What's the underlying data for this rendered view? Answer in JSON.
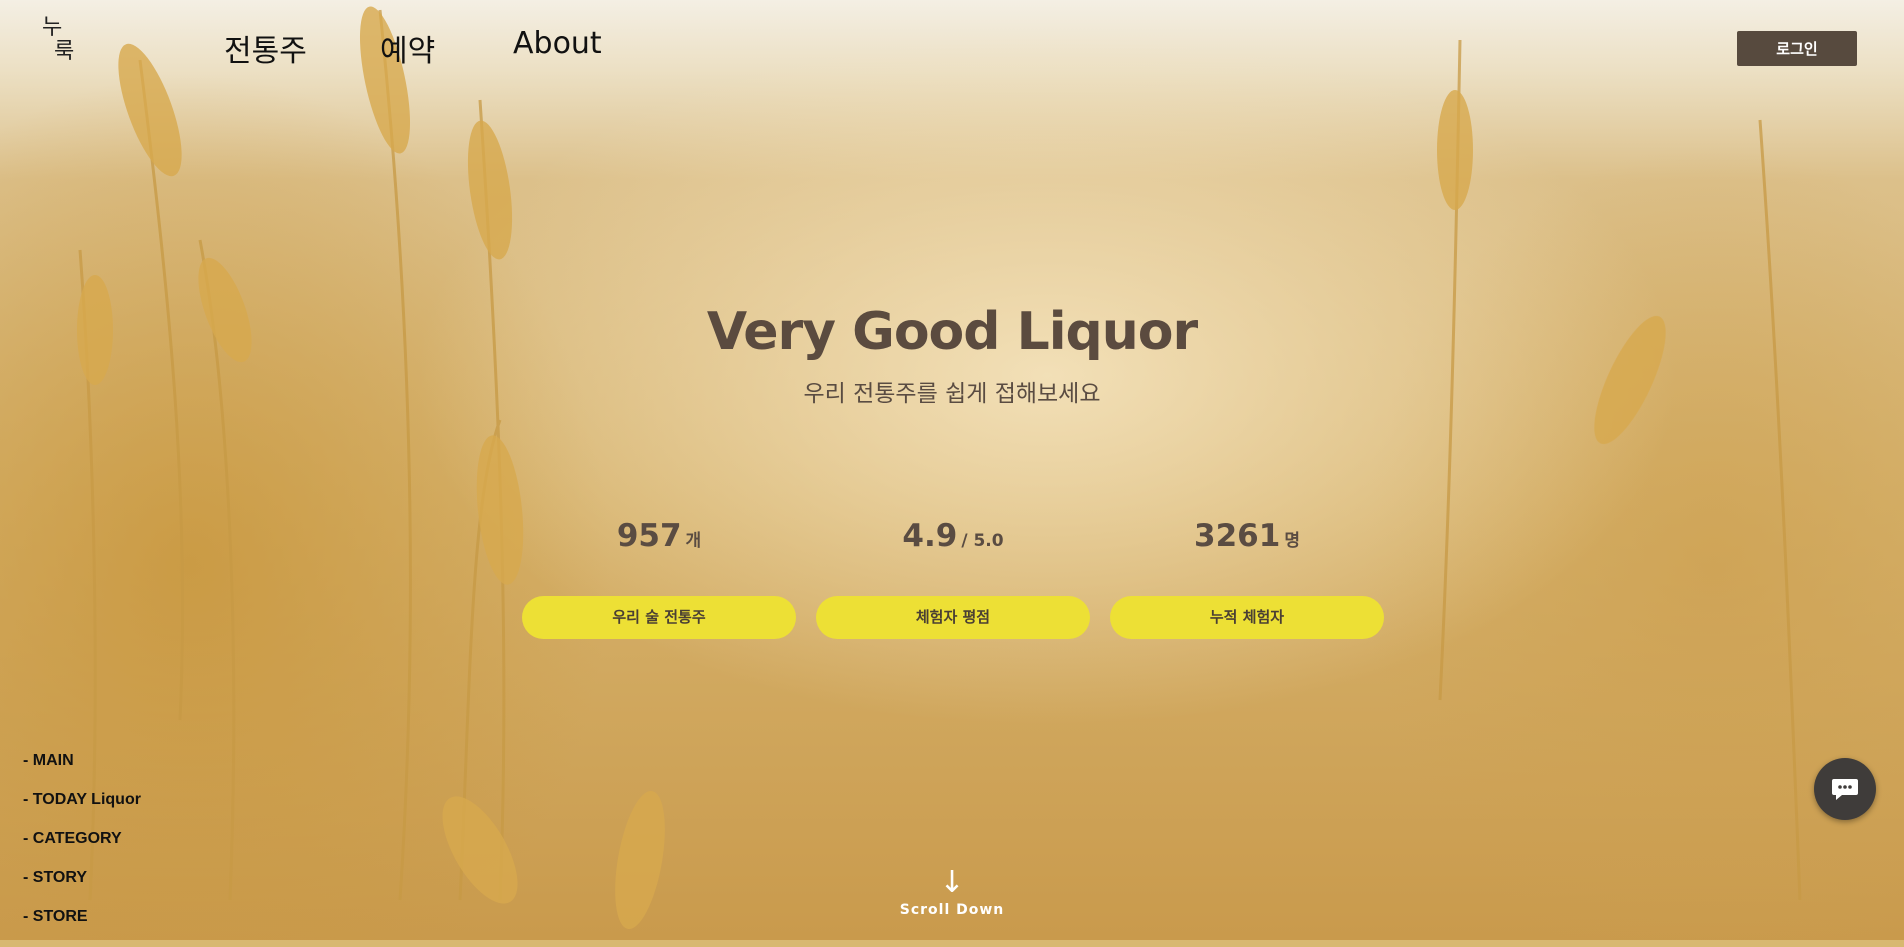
{
  "header": {
    "logo_line1": "누",
    "logo_line2": "룩",
    "nav": [
      "전통주",
      "예약",
      "About"
    ],
    "login_label": "로그인"
  },
  "hero": {
    "title": "Very Good Liquor",
    "subtitle": "우리 전통주를 쉽게 접해보세요"
  },
  "stats": [
    {
      "value": "957",
      "unit": "개",
      "label": "우리 술 전통주"
    },
    {
      "value": "4.9",
      "unit": "/ 5.0",
      "label": "체험자 평점"
    },
    {
      "value": "3261",
      "unit": "명",
      "label": "누적 체험자"
    }
  ],
  "side_nav": [
    "- MAIN",
    "- TODAY Liquor",
    "- CATEGORY",
    "- STORY",
    "- STORE"
  ],
  "scroll": {
    "arrow": "↓",
    "label": "Scroll Down"
  },
  "chat": {
    "icon": "chat-bubble-icon"
  },
  "colors": {
    "accent_yellow": "#ede035",
    "login_bg": "#574a3e",
    "text_brown": "#5b4b3f"
  }
}
